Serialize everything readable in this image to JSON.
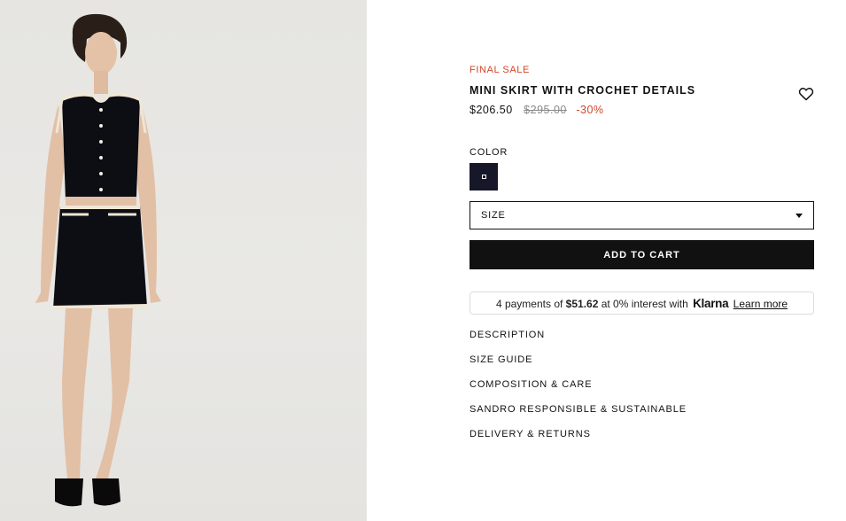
{
  "product": {
    "badge": "FINAL SALE",
    "title": "MINI SKIRT WITH CROCHET DETAILS",
    "price_current": "$206.50",
    "price_original": "$295.00",
    "discount": "-30%",
    "wishlist_icon": "heart-icon"
  },
  "color": {
    "label": "COLOR",
    "selected_swatch": "#17172a"
  },
  "size": {
    "label": "SIZE",
    "icon": "caret-down-icon"
  },
  "cart": {
    "button_label": "ADD TO CART"
  },
  "klarna": {
    "prefix": "4 payments of",
    "amount": "$51.62",
    "middle": "at 0% interest with",
    "brand": "Klarna",
    "link": "Learn more"
  },
  "accordion": [
    "DESCRIPTION",
    "SIZE GUIDE",
    "COMPOSITION & CARE",
    "SANDRO RESPONSIBLE & SUSTAINABLE",
    "DELIVERY & RETURNS"
  ],
  "colors": {
    "sale_accent": "#d2452b",
    "primary": "#111111"
  }
}
